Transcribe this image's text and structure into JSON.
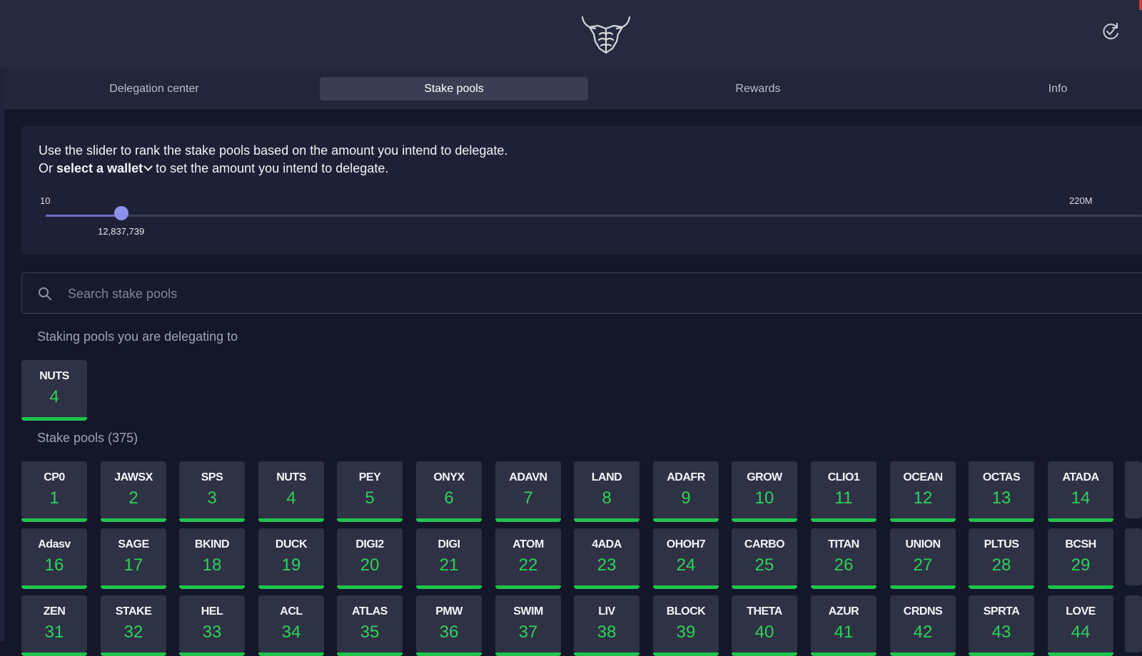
{
  "header": {
    "logo_icon": "bull-head-logo",
    "sync_icon": "refresh-check-icon"
  },
  "tabs": [
    {
      "label": "Delegation center",
      "active": false
    },
    {
      "label": "Stake pools",
      "active": true
    },
    {
      "label": "Rewards",
      "active": false
    },
    {
      "label": "Info",
      "active": false
    }
  ],
  "slider": {
    "line1": "Use the slider to rank the stake pools based on the amount you intend to delegate.",
    "line2_prefix": "Or",
    "wallet_link": "select a wallet",
    "line2_suffix": "to set the amount you intend to delegate.",
    "min_label": "10",
    "max_label": "220M",
    "value_label": "12,837,739",
    "min_value": 10,
    "max_value": 220000000,
    "value": 12837739
  },
  "search": {
    "placeholder": "Search stake pools",
    "value": ""
  },
  "delegating": {
    "title": "Staking pools you are delegating to",
    "pools": [
      {
        "ticker": "NUTS",
        "rank": "4"
      }
    ]
  },
  "stake_pools": {
    "title": "Stake pools (375)",
    "rows": [
      [
        {
          "ticker": "CP0",
          "rank": "1"
        },
        {
          "ticker": "JAWSX",
          "rank": "2"
        },
        {
          "ticker": "SPS",
          "rank": "3"
        },
        {
          "ticker": "NUTS",
          "rank": "4"
        },
        {
          "ticker": "PEY",
          "rank": "5"
        },
        {
          "ticker": "ONYX",
          "rank": "6"
        },
        {
          "ticker": "ADAVN",
          "rank": "7"
        },
        {
          "ticker": "LAND",
          "rank": "8"
        },
        {
          "ticker": "ADAFR",
          "rank": "9"
        },
        {
          "ticker": "GROW",
          "rank": "10"
        },
        {
          "ticker": "CLIO1",
          "rank": "11"
        },
        {
          "ticker": "OCEAN",
          "rank": "12"
        },
        {
          "ticker": "OCTAS",
          "rank": "13"
        },
        {
          "ticker": "ATADA",
          "rank": "14"
        }
      ],
      [
        {
          "ticker": "Adasv",
          "rank": "16"
        },
        {
          "ticker": "SAGE",
          "rank": "17"
        },
        {
          "ticker": "BKIND",
          "rank": "18"
        },
        {
          "ticker": "DUCK",
          "rank": "19"
        },
        {
          "ticker": "DIGI2",
          "rank": "20"
        },
        {
          "ticker": "DIGI",
          "rank": "21"
        },
        {
          "ticker": "ATOM",
          "rank": "22"
        },
        {
          "ticker": "4ADA",
          "rank": "23"
        },
        {
          "ticker": "OHOH7",
          "rank": "24"
        },
        {
          "ticker": "CARBO",
          "rank": "25"
        },
        {
          "ticker": "TITAN",
          "rank": "26"
        },
        {
          "ticker": "UNION",
          "rank": "27"
        },
        {
          "ticker": "PLTUS",
          "rank": "28"
        },
        {
          "ticker": "BCSH",
          "rank": "29"
        }
      ],
      [
        {
          "ticker": "ZEN",
          "rank": "31"
        },
        {
          "ticker": "STAKE",
          "rank": "32"
        },
        {
          "ticker": "HEL",
          "rank": "33"
        },
        {
          "ticker": "ACL",
          "rank": "34"
        },
        {
          "ticker": "ATLAS",
          "rank": "35"
        },
        {
          "ticker": "PMW",
          "rank": "36"
        },
        {
          "ticker": "SWIM",
          "rank": "37"
        },
        {
          "ticker": "LIV",
          "rank": "38"
        },
        {
          "ticker": "BLOCK",
          "rank": "39"
        },
        {
          "ticker": "THETA",
          "rank": "40"
        },
        {
          "ticker": "AZUR",
          "rank": "41"
        },
        {
          "ticker": "CRDNS",
          "rank": "42"
        },
        {
          "ticker": "SPRTA",
          "rank": "43"
        },
        {
          "ticker": "LOVE",
          "rank": "44"
        }
      ]
    ]
  },
  "colors": {
    "accent_green": "#20c24c",
    "slider_thumb": "#8d91ee",
    "background": "#14162a"
  }
}
